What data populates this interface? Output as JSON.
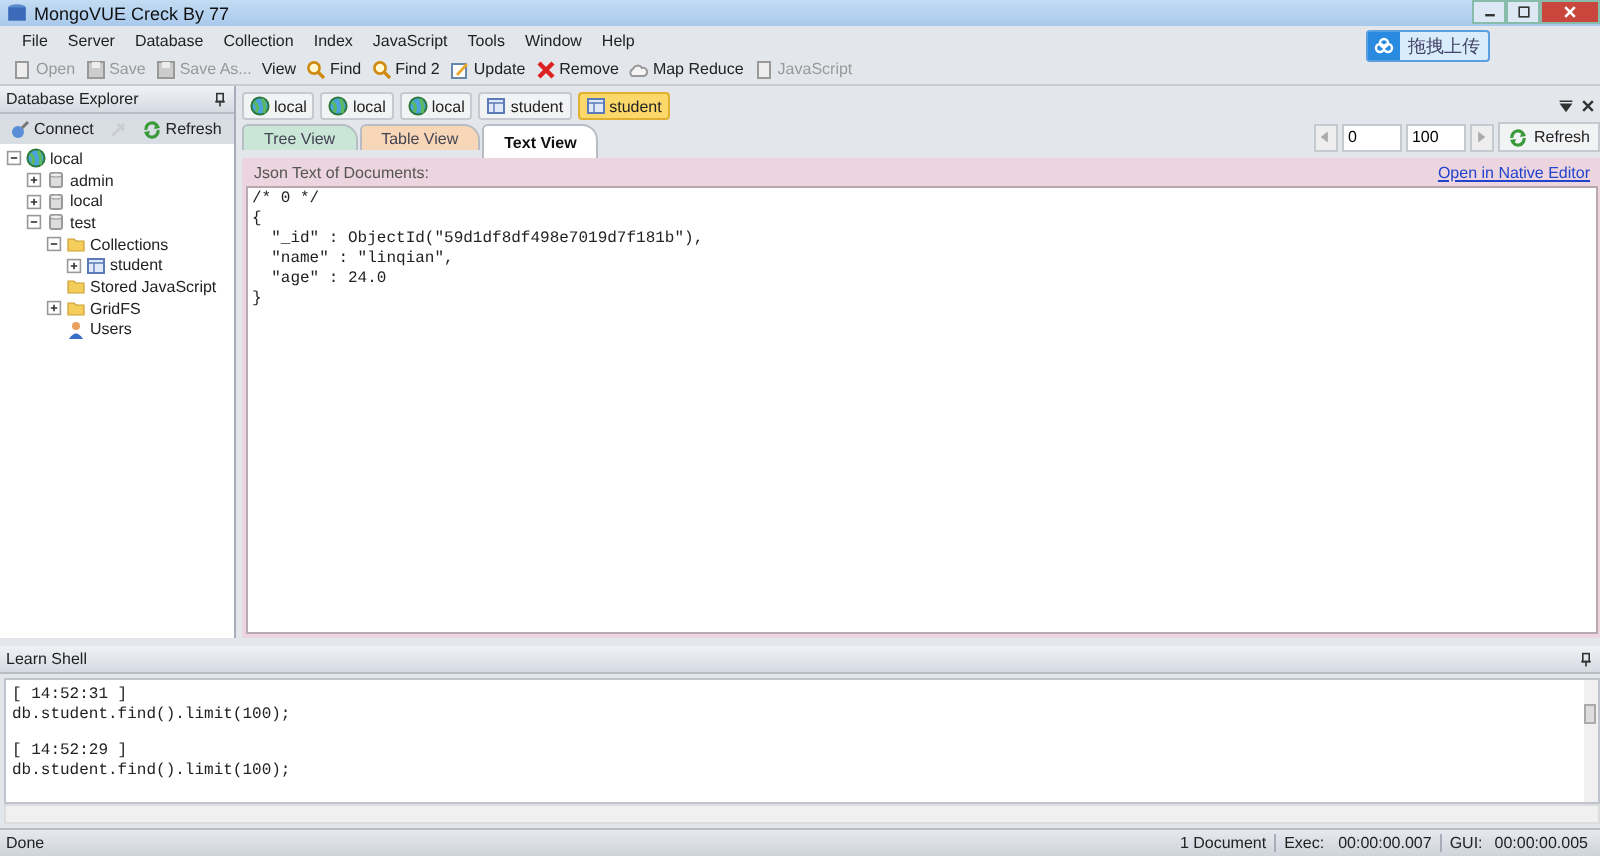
{
  "window": {
    "title": "MongoVUE Creck By 77"
  },
  "menu": [
    "File",
    "Server",
    "Database",
    "Collection",
    "Index",
    "JavaScript",
    "Tools",
    "Window",
    "Help"
  ],
  "toolbar": [
    {
      "label": "Open",
      "kind": "doc",
      "disabled": true
    },
    {
      "label": "Save",
      "kind": "disk",
      "disabled": true
    },
    {
      "label": "Save As...",
      "kind": "disk",
      "disabled": true
    },
    {
      "label": "View",
      "kind": "none",
      "disabled": false
    },
    {
      "label": "Find",
      "kind": "magnifier",
      "disabled": false
    },
    {
      "label": "Find 2",
      "kind": "magnifier",
      "disabled": false
    },
    {
      "label": "Update",
      "kind": "pencil",
      "disabled": false
    },
    {
      "label": "Remove",
      "kind": "cross",
      "disabled": false
    },
    {
      "label": "Map Reduce",
      "kind": "cloud",
      "disabled": false
    },
    {
      "label": "JavaScript",
      "kind": "doc",
      "disabled": true
    }
  ],
  "upload_button": {
    "label": "拖拽上传"
  },
  "doc_tabs": [
    {
      "label": "local",
      "kind": "server",
      "selected": false
    },
    {
      "label": "local",
      "kind": "server",
      "selected": false
    },
    {
      "label": "local",
      "kind": "server",
      "selected": false
    },
    {
      "label": "student",
      "kind": "collection",
      "selected": false
    },
    {
      "label": "student",
      "kind": "collection",
      "selected": true
    }
  ],
  "explorer": {
    "title": "Database Explorer",
    "buttons": [
      {
        "label": "Connect",
        "kind": "connect",
        "disabled": false
      },
      {
        "kind": "plug",
        "disabled": true
      },
      {
        "label": "Refresh",
        "kind": "refresh",
        "disabled": false
      }
    ],
    "tree": [
      {
        "label": "local",
        "kind": "server",
        "expanded": true,
        "children": [
          {
            "label": "admin",
            "kind": "database",
            "expanded": false
          },
          {
            "label": "local",
            "kind": "database",
            "expanded": false
          },
          {
            "label": "test",
            "kind": "database",
            "expanded": true,
            "children": [
              {
                "label": "Collections",
                "kind": "folder",
                "expanded": true,
                "children": [
                  {
                    "label": "student",
                    "kind": "collection",
                    "expanded": false
                  }
                ]
              },
              {
                "label": "Stored JavaScript",
                "kind": "folder"
              },
              {
                "label": "GridFS",
                "kind": "folder",
                "expanded": false
              },
              {
                "label": "Users",
                "kind": "user"
              }
            ]
          }
        ]
      }
    ]
  },
  "view_tabs": [
    {
      "label": "Tree View",
      "color": "#c9e6d6",
      "selected": false
    },
    {
      "label": "Table View",
      "color": "#f7d7b8",
      "selected": false
    },
    {
      "label": "Text View",
      "color": "#ffffff",
      "selected": true
    }
  ],
  "paging": {
    "skip": "0",
    "limit": "100",
    "refresh": "Refresh"
  },
  "text_view": {
    "caption": "Json Text of Documents:",
    "link": "Open in Native Editor",
    "lines": [
      "/* 0 */",
      "{",
      "  \"_id\" : ObjectId(\"59d1df8df498e7019d7f181b\"),",
      "  \"name\" : \"linqian\",",
      "  \"age\" : 24.0",
      "}"
    ]
  },
  "shell": {
    "title": "Learn Shell",
    "entries": [
      {
        "time": "[ 14:52:31 ]",
        "command": "db.student.find().limit(100);"
      },
      {
        "time": "[ 14:52:29 ]",
        "command": "db.student.find().limit(100);"
      }
    ]
  },
  "status_bar": {
    "text": "Done",
    "count": "1 Document",
    "exec_label": "Exec:",
    "exec": "00:00:00.007",
    "gui_label": "GUI:",
    "gui": "00:00:00.005"
  }
}
